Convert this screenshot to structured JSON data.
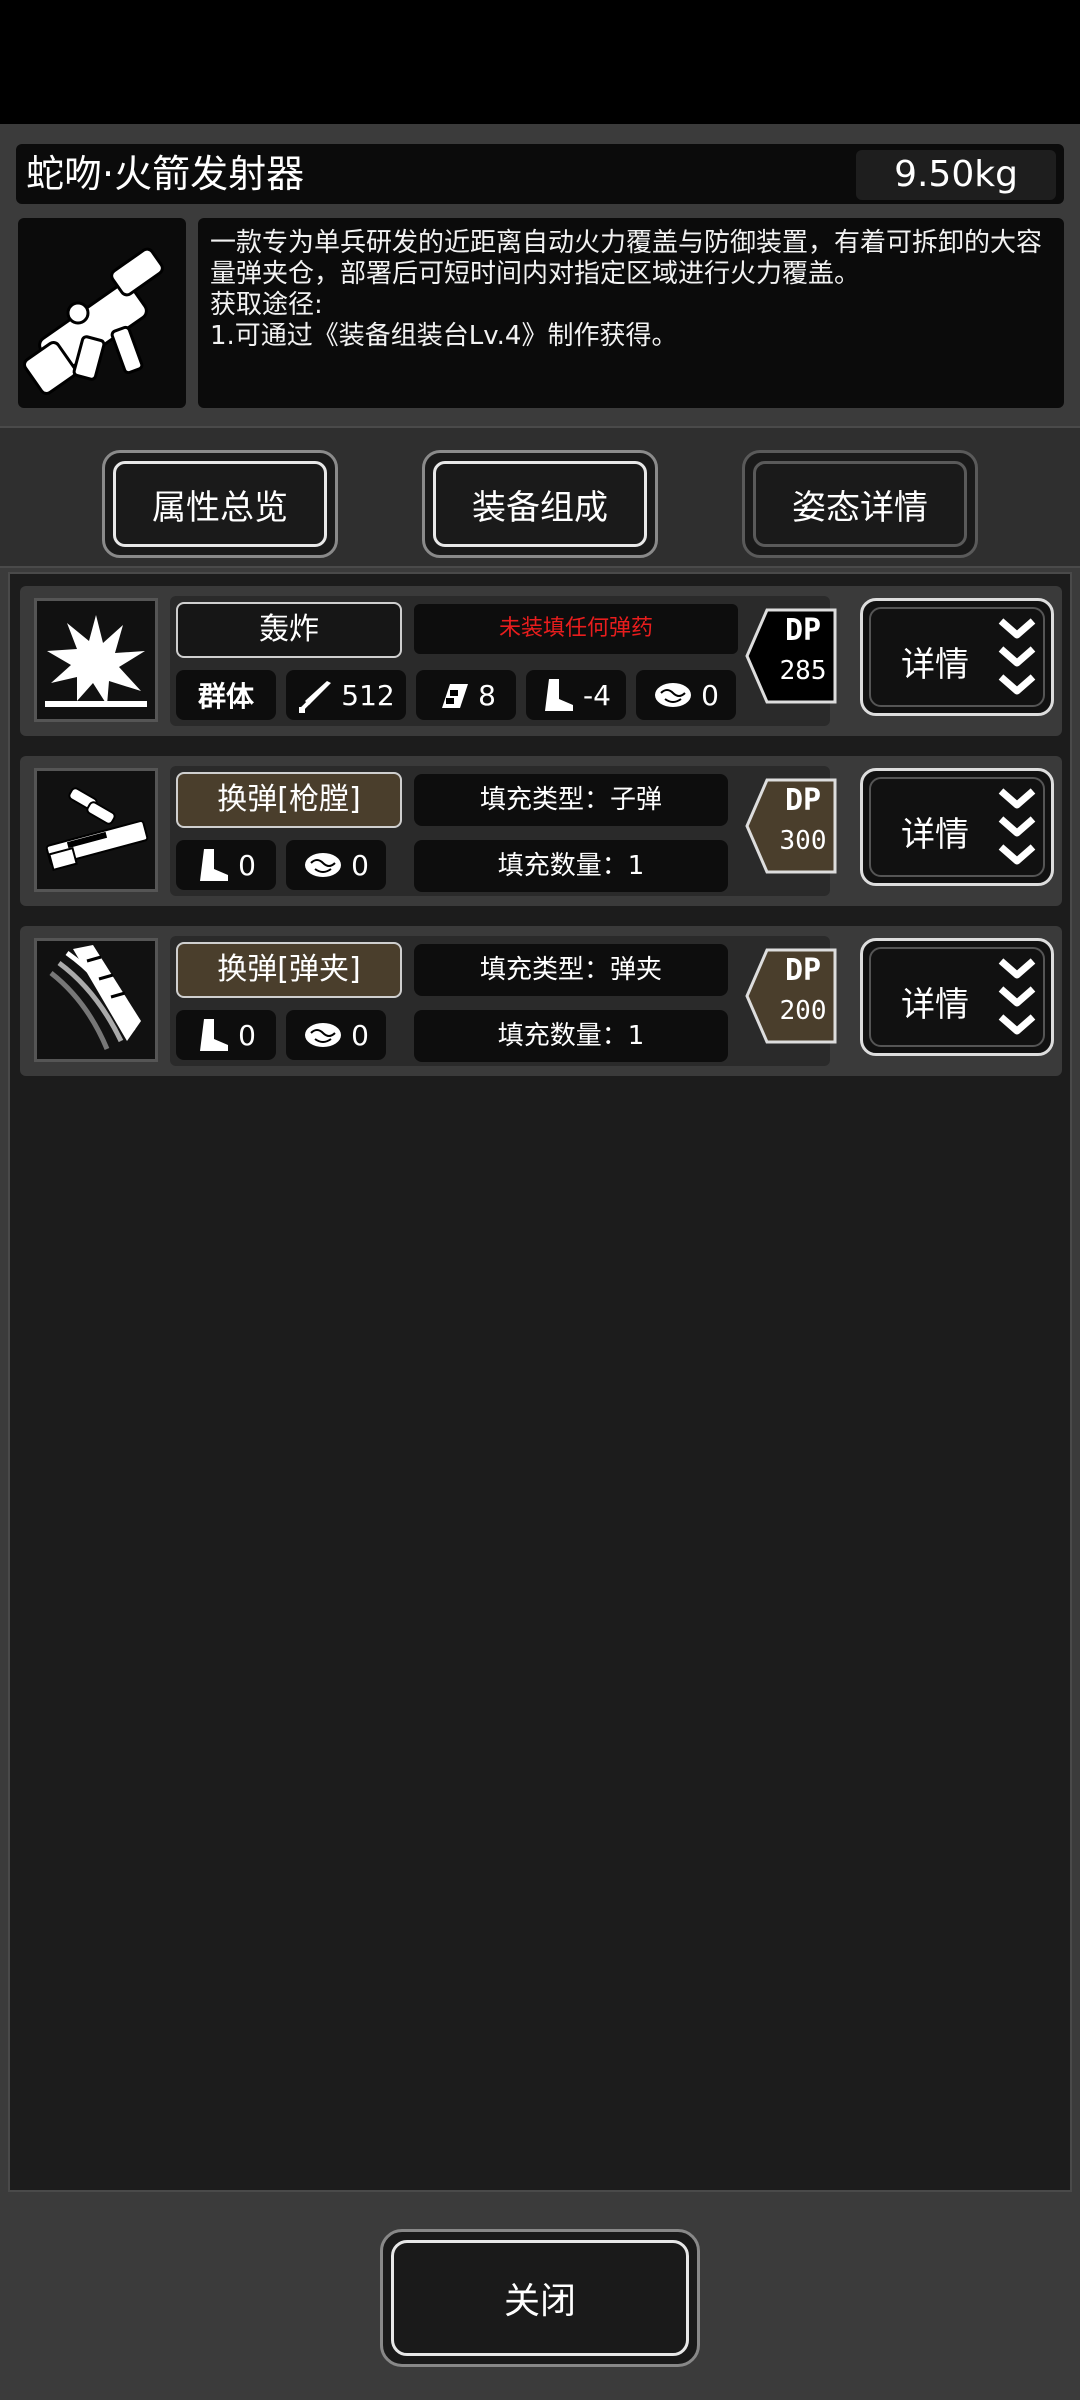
{
  "item": {
    "title": "蛇吻·火箭发射器",
    "weight": "9.50kg",
    "description": [
      "一款专为单兵研发的近距离自动火力覆盖与防御装置，有着可拆卸的大容量弹夹仓，部署后可短时间内对指定区域进行火力覆盖。",
      "获取途径:",
      "1.可通过《装备组装台Lv.4》制作获得。"
    ],
    "icon": "rocket-launcher-icon"
  },
  "tabs": [
    {
      "label": "属性总览",
      "active": false
    },
    {
      "label": "装备组成",
      "active": false
    },
    {
      "label": "姿态详情",
      "active": true
    }
  ],
  "rows": [
    {
      "icon": "explosion-icon",
      "name": "轰炸",
      "status": "未装填任何弹药",
      "target": "群体",
      "damage": "512",
      "hits": "8",
      "move": "-4",
      "noise": "0",
      "dp_label": "DP",
      "dp_value": "285",
      "detail": "详情"
    },
    {
      "icon": "reload-chamber-icon",
      "name": "换弹[枪膛]",
      "fill_type": "填充类型：子弹",
      "fill_count": "填充数量：1",
      "move": "0",
      "noise": "0",
      "dp_label": "DP",
      "dp_value": "300",
      "detail": "详情"
    },
    {
      "icon": "reload-magazine-icon",
      "name": "换弹[弹夹]",
      "fill_type": "填充类型：弹夹",
      "fill_count": "填充数量：1",
      "move": "0",
      "noise": "0",
      "dp_label": "DP",
      "dp_value": "200",
      "detail": "详情"
    }
  ],
  "close_label": "关闭",
  "colors": {
    "warning": "#e81d1d",
    "brown_pill": "#4a3e2c",
    "dp_brown": "#4a3e2c"
  }
}
